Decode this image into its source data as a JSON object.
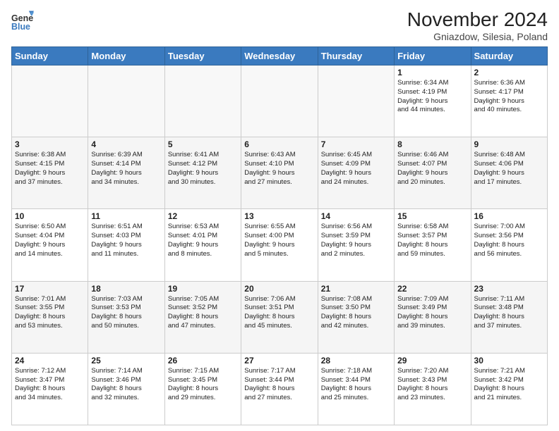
{
  "header": {
    "logo_general": "General",
    "logo_blue": "Blue",
    "month_title": "November 2024",
    "location": "Gniazdow, Silesia, Poland"
  },
  "calendar": {
    "headers": [
      "Sunday",
      "Monday",
      "Tuesday",
      "Wednesday",
      "Thursday",
      "Friday",
      "Saturday"
    ],
    "weeks": [
      {
        "shade": "white",
        "days": [
          {
            "num": "",
            "info": "",
            "empty": true
          },
          {
            "num": "",
            "info": "",
            "empty": true
          },
          {
            "num": "",
            "info": "",
            "empty": true
          },
          {
            "num": "",
            "info": "",
            "empty": true
          },
          {
            "num": "",
            "info": "",
            "empty": true
          },
          {
            "num": "1",
            "info": "Sunrise: 6:34 AM\nSunset: 4:19 PM\nDaylight: 9 hours\nand 44 minutes.",
            "empty": false
          },
          {
            "num": "2",
            "info": "Sunrise: 6:36 AM\nSunset: 4:17 PM\nDaylight: 9 hours\nand 40 minutes.",
            "empty": false
          }
        ]
      },
      {
        "shade": "gray",
        "days": [
          {
            "num": "3",
            "info": "Sunrise: 6:38 AM\nSunset: 4:15 PM\nDaylight: 9 hours\nand 37 minutes.",
            "empty": false
          },
          {
            "num": "4",
            "info": "Sunrise: 6:39 AM\nSunset: 4:14 PM\nDaylight: 9 hours\nand 34 minutes.",
            "empty": false
          },
          {
            "num": "5",
            "info": "Sunrise: 6:41 AM\nSunset: 4:12 PM\nDaylight: 9 hours\nand 30 minutes.",
            "empty": false
          },
          {
            "num": "6",
            "info": "Sunrise: 6:43 AM\nSunset: 4:10 PM\nDaylight: 9 hours\nand 27 minutes.",
            "empty": false
          },
          {
            "num": "7",
            "info": "Sunrise: 6:45 AM\nSunset: 4:09 PM\nDaylight: 9 hours\nand 24 minutes.",
            "empty": false
          },
          {
            "num": "8",
            "info": "Sunrise: 6:46 AM\nSunset: 4:07 PM\nDaylight: 9 hours\nand 20 minutes.",
            "empty": false
          },
          {
            "num": "9",
            "info": "Sunrise: 6:48 AM\nSunset: 4:06 PM\nDaylight: 9 hours\nand 17 minutes.",
            "empty": false
          }
        ]
      },
      {
        "shade": "white",
        "days": [
          {
            "num": "10",
            "info": "Sunrise: 6:50 AM\nSunset: 4:04 PM\nDaylight: 9 hours\nand 14 minutes.",
            "empty": false
          },
          {
            "num": "11",
            "info": "Sunrise: 6:51 AM\nSunset: 4:03 PM\nDaylight: 9 hours\nand 11 minutes.",
            "empty": false
          },
          {
            "num": "12",
            "info": "Sunrise: 6:53 AM\nSunset: 4:01 PM\nDaylight: 9 hours\nand 8 minutes.",
            "empty": false
          },
          {
            "num": "13",
            "info": "Sunrise: 6:55 AM\nSunset: 4:00 PM\nDaylight: 9 hours\nand 5 minutes.",
            "empty": false
          },
          {
            "num": "14",
            "info": "Sunrise: 6:56 AM\nSunset: 3:59 PM\nDaylight: 9 hours\nand 2 minutes.",
            "empty": false
          },
          {
            "num": "15",
            "info": "Sunrise: 6:58 AM\nSunset: 3:57 PM\nDaylight: 8 hours\nand 59 minutes.",
            "empty": false
          },
          {
            "num": "16",
            "info": "Sunrise: 7:00 AM\nSunset: 3:56 PM\nDaylight: 8 hours\nand 56 minutes.",
            "empty": false
          }
        ]
      },
      {
        "shade": "gray",
        "days": [
          {
            "num": "17",
            "info": "Sunrise: 7:01 AM\nSunset: 3:55 PM\nDaylight: 8 hours\nand 53 minutes.",
            "empty": false
          },
          {
            "num": "18",
            "info": "Sunrise: 7:03 AM\nSunset: 3:53 PM\nDaylight: 8 hours\nand 50 minutes.",
            "empty": false
          },
          {
            "num": "19",
            "info": "Sunrise: 7:05 AM\nSunset: 3:52 PM\nDaylight: 8 hours\nand 47 minutes.",
            "empty": false
          },
          {
            "num": "20",
            "info": "Sunrise: 7:06 AM\nSunset: 3:51 PM\nDaylight: 8 hours\nand 45 minutes.",
            "empty": false
          },
          {
            "num": "21",
            "info": "Sunrise: 7:08 AM\nSunset: 3:50 PM\nDaylight: 8 hours\nand 42 minutes.",
            "empty": false
          },
          {
            "num": "22",
            "info": "Sunrise: 7:09 AM\nSunset: 3:49 PM\nDaylight: 8 hours\nand 39 minutes.",
            "empty": false
          },
          {
            "num": "23",
            "info": "Sunrise: 7:11 AM\nSunset: 3:48 PM\nDaylight: 8 hours\nand 37 minutes.",
            "empty": false
          }
        ]
      },
      {
        "shade": "white",
        "days": [
          {
            "num": "24",
            "info": "Sunrise: 7:12 AM\nSunset: 3:47 PM\nDaylight: 8 hours\nand 34 minutes.",
            "empty": false
          },
          {
            "num": "25",
            "info": "Sunrise: 7:14 AM\nSunset: 3:46 PM\nDaylight: 8 hours\nand 32 minutes.",
            "empty": false
          },
          {
            "num": "26",
            "info": "Sunrise: 7:15 AM\nSunset: 3:45 PM\nDaylight: 8 hours\nand 29 minutes.",
            "empty": false
          },
          {
            "num": "27",
            "info": "Sunrise: 7:17 AM\nSunset: 3:44 PM\nDaylight: 8 hours\nand 27 minutes.",
            "empty": false
          },
          {
            "num": "28",
            "info": "Sunrise: 7:18 AM\nSunset: 3:44 PM\nDaylight: 8 hours\nand 25 minutes.",
            "empty": false
          },
          {
            "num": "29",
            "info": "Sunrise: 7:20 AM\nSunset: 3:43 PM\nDaylight: 8 hours\nand 23 minutes.",
            "empty": false
          },
          {
            "num": "30",
            "info": "Sunrise: 7:21 AM\nSunset: 3:42 PM\nDaylight: 8 hours\nand 21 minutes.",
            "empty": false
          }
        ]
      }
    ]
  }
}
